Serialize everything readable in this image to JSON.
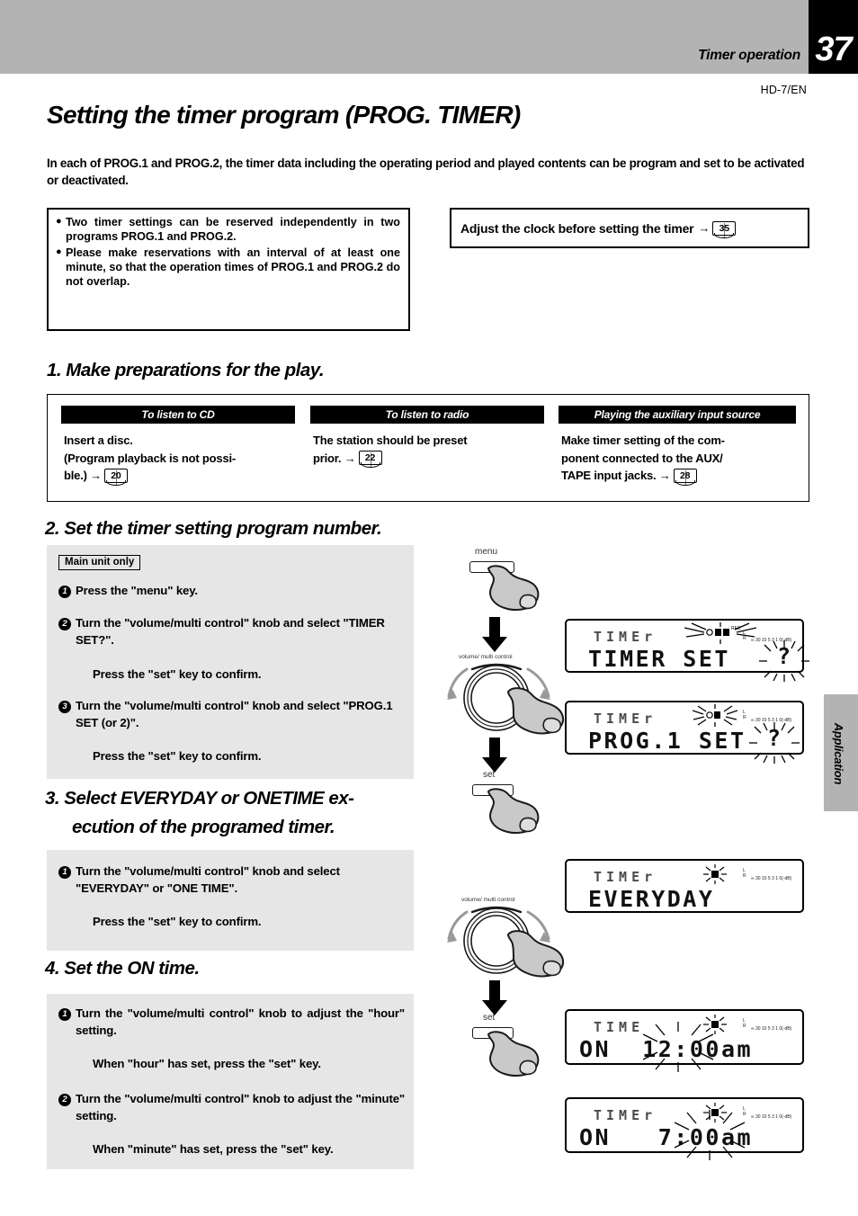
{
  "header": {
    "section_title": "Timer operation",
    "page_number": "37",
    "model_code": "HD-7/EN",
    "side_tab": "Application"
  },
  "main": {
    "title": "Setting the timer program (PROG. TIMER)",
    "intro": "In each of PROG.1 and PROG.2, the timer data including the operating period and played contents can be program and set to be activated or deactivated."
  },
  "notes": {
    "bullet_glyph": "●",
    "items": [
      "Two timer settings can be reserved independently in two programs PROG.1 and PROG.2.",
      "Please make reservations with an interval of at least one minute, so that the operation times of PROG.1 and PROG.2 do not overlap."
    ]
  },
  "clock_note": {
    "text": "Adjust the clock before setting the timer",
    "arrow": "→",
    "page_ref": "35"
  },
  "steps": {
    "step1": {
      "heading": "1. Make preparations for the play.",
      "columns": [
        {
          "head": "To listen to CD",
          "lines": [
            "Insert a disc.",
            "(Program playback is not possi-",
            "ble.) →"
          ],
          "page_ref": "20"
        },
        {
          "head": "To listen to radio",
          "lines": [
            "The station should be preset",
            "prior.   →"
          ],
          "page_ref": "22"
        },
        {
          "head": "Playing the auxiliary input source",
          "lines": [
            "Make timer setting of the com-",
            "ponent connected to the AUX/",
            "TAPE input jacks. →"
          ],
          "page_ref": "28"
        }
      ]
    },
    "step2": {
      "heading": "2. Set the timer setting program number.",
      "badge": "Main unit only",
      "instructions": [
        {
          "num": "1",
          "text": "Press the \"menu\" key."
        },
        {
          "num": "2",
          "text": "Turn the \"volume/multi control\" knob and select \"TIMER SET?\".",
          "sub": "Press the \"set\" key to confirm."
        },
        {
          "num": "3",
          "text": "Turn the \"volume/multi control\" knob and select \"PROG.1 SET (or 2)\".",
          "sub": "Press the \"set\" key to confirm."
        }
      ]
    },
    "step3": {
      "heading_line1": "3. Select EVERYDAY  or ONETIME ex-",
      "heading_line2": "ecution of the programed timer.",
      "instructions": [
        {
          "num": "1",
          "text": "Turn the \"volume/multi control\" knob and select \"EVERYDAY\" or \"ONE TIME\".",
          "sub": "Press the \"set\" key to confirm."
        }
      ]
    },
    "step4": {
      "heading": "4. Set the ON time.",
      "instructions": [
        {
          "num": "1",
          "text": "Turn the \"volume/multi control\" knob to adjust the \"hour\" setting.",
          "sub": "When \"hour\" has set, press the \"set\" key."
        },
        {
          "num": "2",
          "text": "Turn the \"volume/multi control\" knob to adjust the \"minute\" setting.",
          "sub": "When \"minute\" has set, press the \"set\" key."
        }
      ]
    }
  },
  "illustrations": {
    "menu_key_label": "menu",
    "set_key_label": "set",
    "knob_label": "volume/ multi control"
  },
  "displays": [
    {
      "indicator": "TIMEr",
      "main": "TIMER SET",
      "flash_suffix": "?",
      "meter": "∞ 30 10  5   3   1  0(-dB)",
      "lr": "L\nR"
    },
    {
      "indicator": "TIMEr",
      "main": "PROG.1 SET",
      "flash_suffix": "?",
      "meter": "∞ 30 10  5   3   1  0(-dB)",
      "lr": "L\nR"
    },
    {
      "indicator": "TIMEr",
      "main": "EVERYDAY",
      "flash_suffix": "",
      "meter": "∞ 30 10  5   3   1  0(-dB)",
      "lr": "L\nR"
    },
    {
      "indicator": "TIME",
      "main": "ON  12:00am",
      "flash_suffix": "",
      "flashing_part": "12",
      "meter": "∞ 30 10  5   3   1  0(-dB)",
      "lr": "L\nR"
    },
    {
      "indicator": "TIMEr",
      "main": "ON   7:00am",
      "flash_suffix": "",
      "flashing_part": "00",
      "meter": "∞ 30 10  5   3   1  0(-dB)",
      "lr": "L\nR"
    }
  ],
  "colors": {
    "header_gray": "#b3b3b3",
    "panel_gray": "#e6e6e6",
    "black": "#000000",
    "white": "#ffffff"
  }
}
